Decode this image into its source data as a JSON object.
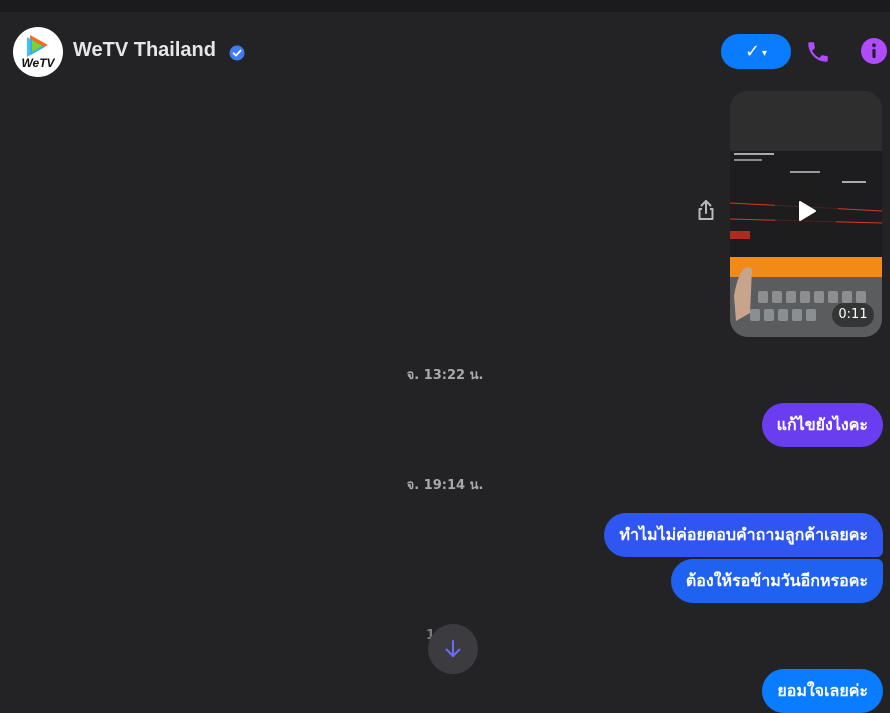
{
  "header": {
    "title": "WeTV Thailand",
    "avatar_text": "WeTV",
    "status_button_label": "✓",
    "status_button_caret": "▾"
  },
  "colors": {
    "background": "#232326",
    "accent_blue": "#0a7cff",
    "icon_purple": "#b04bff",
    "bubble_purple": "#6a3df0",
    "bubble_blue": "#2f56f0"
  },
  "messages": {
    "video": {
      "duration": "0:11"
    },
    "timestamp_1": "จ. 13:22 น.",
    "msg_1": "แก้ไขยังไงคะ",
    "timestamp_2": "จ. 19:14 น.",
    "msg_2": "ทำไมไม่ค่อยตอบคำถามลูกค้าเลยคะ",
    "msg_3": "ต้องให้รอข้ามวันอีกหรอคะ",
    "timestamp_3_partial": "1",
    "msg_4": "ยอมใจเลยค่ะ"
  },
  "icons": {
    "verified": "verified-badge-icon",
    "phone": "phone-icon",
    "info": "info-icon",
    "share": "share-icon",
    "play": "play-icon",
    "scroll": "arrow-down-icon"
  }
}
